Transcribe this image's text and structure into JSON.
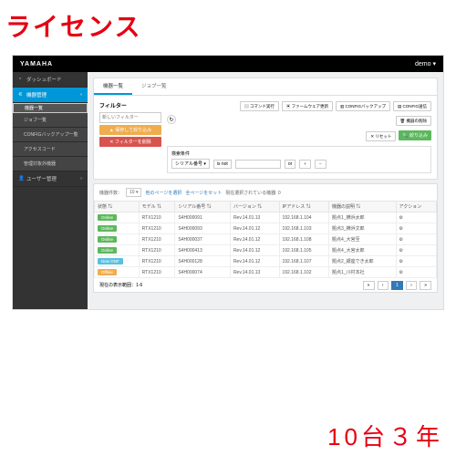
{
  "overlay": {
    "top": "ライセンス",
    "bottom": "10台３年"
  },
  "header": {
    "brand": "YAMAHA",
    "user": "demo"
  },
  "sidebar": {
    "items": [
      {
        "label": "ダッシュボード"
      },
      {
        "label": "機器管理"
      },
      {
        "label": "機器一覧"
      },
      {
        "label": "ジョブ一覧"
      },
      {
        "label": "CONFIGバックアップ一覧"
      },
      {
        "label": "アクセスコード"
      },
      {
        "label": "管理対象外機器"
      },
      {
        "label": "ユーザー管理"
      }
    ]
  },
  "tabs": {
    "devices": "機器一覧",
    "jobs": "ジョブ一覧"
  },
  "filter": {
    "title": "フィルター",
    "placeholder": "新しいフィルター",
    "save": "▲ 保存して絞り込み",
    "delete": "✕ フィルターを削除"
  },
  "toolbar": {
    "cmd": "コマンド実行",
    "fw": "ファームウェア更新",
    "backup": "CONFIGバックアップ",
    "send": "CONFIG送信",
    "del": "機器の削除",
    "reset": "✕ リセット",
    "apply": "絞り込み"
  },
  "cond": {
    "title": "検索条件",
    "field": "シリアル番号 ▾",
    "op1": "is not",
    "op2": "or",
    "add": "+",
    "remove": "−"
  },
  "table_ctl": {
    "items": "機器件数：",
    "per": "10 ▾",
    "pagedel": "他のページを選択",
    "allsel": "全ページをセット",
    "selected": "現在選択されている機器: 0"
  },
  "columns": {
    "status": "状態 ⇅",
    "model": "モデル ⇅",
    "serial": "シリアル番号 ⇅",
    "ver": "バージョン ⇅",
    "ip": "IPアドレス ⇅",
    "owner": "機器の説明 ⇅",
    "action": "アクション"
  },
  "chart_data": {
    "type": "table",
    "rows": [
      {
        "status": "Online",
        "model": "RTX1210",
        "serial": "S4H000091",
        "ver": "Rev.14.01.13",
        "ip": "192.168.1.104",
        "owner": "拠点1_横浜太郎",
        "action": "⚙"
      },
      {
        "status": "Online",
        "model": "RTX1210",
        "serial": "S4H000093",
        "ver": "Rev.14.01.12",
        "ip": "192.168.1.103",
        "owner": "拠点3_横浜文郎",
        "action": "⚙"
      },
      {
        "status": "Online",
        "model": "RTX1210",
        "serial": "S4H000037",
        "ver": "Rev.14.01.12",
        "ip": "192.168.1.108",
        "owner": "拠点4_大宮至",
        "action": "⚙"
      },
      {
        "status": "Online",
        "model": "RTX1210",
        "serial": "S4H000413",
        "ver": "Rev.14.01.12",
        "ip": "192.168.1.105",
        "owner": "拠点4_大宮太郎",
        "action": "⚙"
      },
      {
        "status": "New ONF",
        "model": "RTX1210",
        "serial": "S4H000128",
        "ver": "Rev.14.01.12",
        "ip": "192.168.1.107",
        "owner": "拠点2_銀座でき太郎",
        "action": "⚙"
      },
      {
        "status": "Offline",
        "model": "RTX1210",
        "serial": "S4H000074",
        "ver": "Rev.14.01.13",
        "ip": "192.168.1.102",
        "owner": "拠点1_川村本社",
        "action": "⚙"
      }
    ]
  },
  "footer": {
    "range": "現在の表示範囲：1-6",
    "page": "1"
  }
}
